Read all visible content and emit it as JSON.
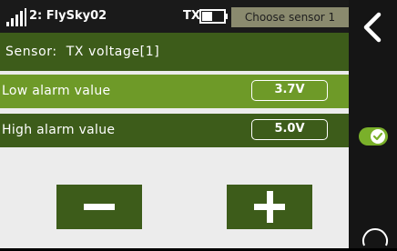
{
  "status": {
    "model_name": "2: FlySky02",
    "tx_label": "TX",
    "screen_title": "Choose sensor 1"
  },
  "sensor": {
    "text": "Sensor:  TX voltage[1]"
  },
  "alarms": {
    "low": {
      "label": "Low alarm value",
      "value": "3.7V"
    },
    "high": {
      "label": "High alarm value",
      "value": "5.0V"
    }
  },
  "icons": {
    "signal": "signal-strength-icon",
    "battery": "battery-icon",
    "back": "chevron-left-icon",
    "toggle": "toggle-on-icon",
    "rotate": "rotate-icon",
    "minus": "minus-icon",
    "plus": "plus-icon"
  },
  "colors": {
    "dark_green": "#3d5c1a",
    "light_green": "#6e9a28",
    "background": "#ececec",
    "title_bg": "#8a8a6e"
  }
}
